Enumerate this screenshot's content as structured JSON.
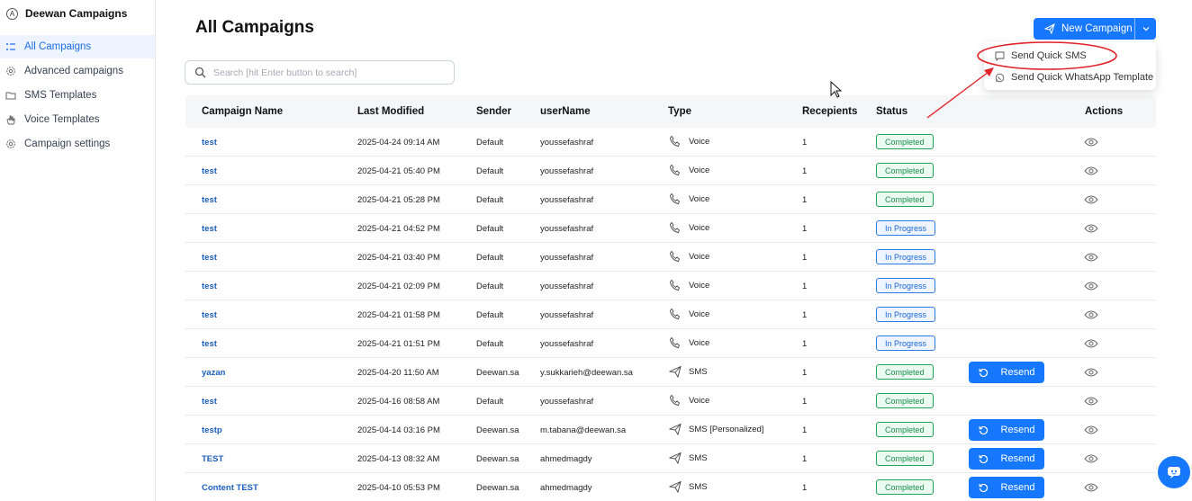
{
  "app": {
    "name": "Deewan Campaigns",
    "logo_icon": "deewan-logo-icon"
  },
  "sidebar": {
    "items": [
      {
        "label": "All Campaigns",
        "icon": "list-icon",
        "active": true
      },
      {
        "label": "Advanced campaigns",
        "icon": "gear-icon",
        "active": false
      },
      {
        "label": "SMS Templates",
        "icon": "folder-icon",
        "active": false
      },
      {
        "label": "Voice Templates",
        "icon": "hand-icon",
        "active": false
      },
      {
        "label": "Campaign settings",
        "icon": "gear-icon",
        "active": false
      }
    ]
  },
  "page": {
    "title": "All Campaigns"
  },
  "search": {
    "placeholder": "Search [hit Enter button to search]",
    "value": ""
  },
  "new_campaign": {
    "label": "New Campaign",
    "menu": [
      {
        "label": "Send Quick SMS",
        "icon": "chat-bubble-icon"
      },
      {
        "label": "Send Quick WhatsApp Template",
        "icon": "whatsapp-icon"
      }
    ]
  },
  "table": {
    "columns": [
      "Campaign Name",
      "Last Modified",
      "Sender",
      "userName",
      "Type",
      "Recepients",
      "Status",
      "Actions"
    ],
    "resend_label": "Resend",
    "rows": [
      {
        "name": "test",
        "modified": "2025-04-24 09:14 AM",
        "sender": "Default",
        "user": "youssefashraf",
        "type": "Voice",
        "recipients": "1",
        "status": "Completed",
        "resend": false
      },
      {
        "name": "test",
        "modified": "2025-04-21 05:40 PM",
        "sender": "Default",
        "user": "youssefashraf",
        "type": "Voice",
        "recipients": "1",
        "status": "Completed",
        "resend": false
      },
      {
        "name": "test",
        "modified": "2025-04-21 05:28 PM",
        "sender": "Default",
        "user": "youssefashraf",
        "type": "Voice",
        "recipients": "1",
        "status": "Completed",
        "resend": false
      },
      {
        "name": "test",
        "modified": "2025-04-21 04:52 PM",
        "sender": "Default",
        "user": "youssefashraf",
        "type": "Voice",
        "recipients": "1",
        "status": "In Progress",
        "resend": false
      },
      {
        "name": "test",
        "modified": "2025-04-21 03:40 PM",
        "sender": "Default",
        "user": "youssefashraf",
        "type": "Voice",
        "recipients": "1",
        "status": "In Progress",
        "resend": false
      },
      {
        "name": "test",
        "modified": "2025-04-21 02:09 PM",
        "sender": "Default",
        "user": "youssefashraf",
        "type": "Voice",
        "recipients": "1",
        "status": "In Progress",
        "resend": false
      },
      {
        "name": "test",
        "modified": "2025-04-21 01:58 PM",
        "sender": "Default",
        "user": "youssefashraf",
        "type": "Voice",
        "recipients": "1",
        "status": "In Progress",
        "resend": false
      },
      {
        "name": "test",
        "modified": "2025-04-21 01:51 PM",
        "sender": "Default",
        "user": "youssefashraf",
        "type": "Voice",
        "recipients": "1",
        "status": "In Progress",
        "resend": false
      },
      {
        "name": "yazan",
        "modified": "2025-04-20 11:50 AM",
        "sender": "Deewan.sa",
        "user": "y.sukkarieh@deewan.sa",
        "type": "SMS",
        "recipients": "1",
        "status": "Completed",
        "resend": true
      },
      {
        "name": "test",
        "modified": "2025-04-16 08:58 AM",
        "sender": "Default",
        "user": "youssefashraf",
        "type": "Voice",
        "recipients": "1",
        "status": "Completed",
        "resend": false
      },
      {
        "name": "testp",
        "modified": "2025-04-14 03:16 PM",
        "sender": "Deewan.sa",
        "user": "m.tabana@deewan.sa",
        "type": "SMS [Personalized]",
        "recipients": "1",
        "status": "Completed",
        "resend": true
      },
      {
        "name": "TEST",
        "modified": "2025-04-13 08:32 AM",
        "sender": "Deewan.sa",
        "user": "ahmedmagdy",
        "type": "SMS",
        "recipients": "1",
        "status": "Completed",
        "resend": true
      },
      {
        "name": "Content TEST",
        "modified": "2025-04-10 05:53 PM",
        "sender": "Deewan.sa",
        "user": "ahmedmagdy",
        "type": "SMS",
        "recipients": "1",
        "status": "Completed",
        "resend": true
      }
    ]
  },
  "colors": {
    "accent": "#1677ff",
    "completed": "#22a25a",
    "in_progress": "#2f7be8",
    "annotation": "#e0242a"
  }
}
